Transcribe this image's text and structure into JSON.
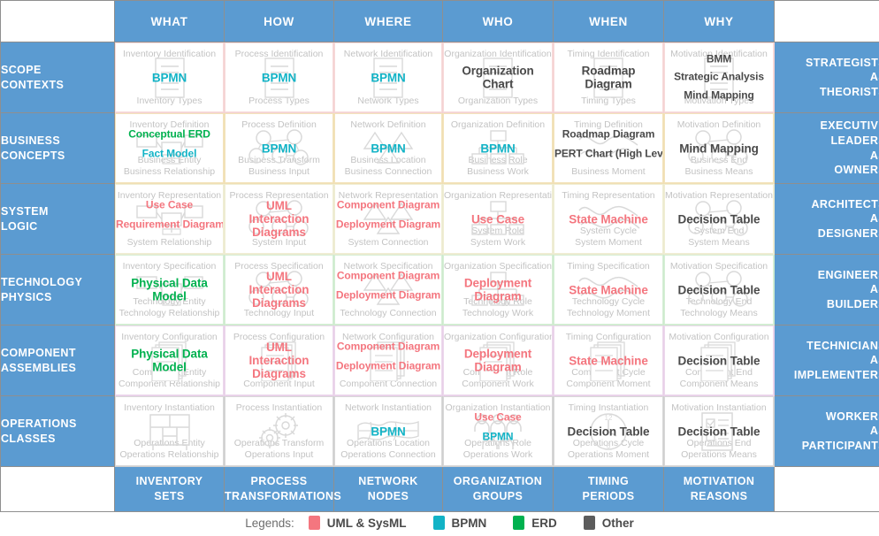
{
  "theme": {
    "header_blue": "#5b9bd1",
    "uml_color": "#f4767f",
    "bpmn_color": "#12b3c6",
    "erd_color": "#00b14f",
    "other_color": "#4a4a4a",
    "caption_gray": "#c3c3c3"
  },
  "columns": [
    {
      "key": "what",
      "label": "WHAT"
    },
    {
      "key": "how",
      "label": "HOW"
    },
    {
      "key": "where",
      "label": "WHERE"
    },
    {
      "key": "who",
      "label": "WHO"
    },
    {
      "key": "when",
      "label": "WHEN"
    },
    {
      "key": "why",
      "label": "WHY"
    }
  ],
  "footer": [
    {
      "line1": "INVENTORY",
      "line2": "SETS"
    },
    {
      "line1": "PROCESS",
      "line2": "TRANSFORMATIONS"
    },
    {
      "line1": "NETWORK",
      "line2": "NODES"
    },
    {
      "line1": "ORGANIZATION",
      "line2": "GROUPS"
    },
    {
      "line1": "TIMING",
      "line2": "PERIODS"
    },
    {
      "line1": "MOTIVATION",
      "line2": "REASONS"
    }
  ],
  "rows": [
    {
      "head_line1": "SCOPE",
      "head_line2": "CONTEXTS",
      "tail": "STRATEGISTS\nAS\nTHEORISTS",
      "tint": "rose",
      "cells": [
        {
          "top": "Inventory Identification",
          "bottom": "Inventory Types",
          "icon": "document-icon",
          "labels": [
            {
              "text": "BPMN",
              "kind": "bpmn"
            }
          ]
        },
        {
          "top": "Process Identification",
          "bottom": "Process Types",
          "icon": "document-icon",
          "labels": [
            {
              "text": "BPMN",
              "kind": "bpmn"
            }
          ]
        },
        {
          "top": "Network Identification",
          "bottom": "Network Types",
          "icon": "document-icon",
          "labels": [
            {
              "text": "BPMN",
              "kind": "bpmn"
            }
          ]
        },
        {
          "top": "Organization Identification",
          "bottom": "Organization Types",
          "icon": "document-icon",
          "labels": [
            {
              "text": "Organization",
              "kind": "other"
            },
            {
              "text": "Chart",
              "kind": "other"
            }
          ]
        },
        {
          "top": "Timing Identification",
          "bottom": "Timing Types",
          "icon": "document-icon",
          "labels": [
            {
              "text": "Roadmap",
              "kind": "other"
            },
            {
              "text": "Diagram",
              "kind": "other"
            }
          ]
        },
        {
          "top": "Motivation Identification",
          "bottom": "Motivation Types",
          "icon": "document-icon",
          "labels": [
            {
              "text": "BMM",
              "kind": "other",
              "size": "sm"
            },
            {
              "text": "Strategic Analysis",
              "kind": "other",
              "size": "sm",
              "gap": "gap-md"
            },
            {
              "text": "Mind Mapping",
              "kind": "other",
              "size": "sm"
            }
          ]
        }
      ]
    },
    {
      "head_line1": "BUSINESS",
      "head_line2": "CONCEPTS",
      "tail": "EXECUTIVE\nLEADERS\nAS\nOWNERS",
      "tint": "amber",
      "cells": [
        {
          "top": "Inventory Definition",
          "bottom": "Business Entity\nBusiness Relationship",
          "icon": "erd-icon",
          "labels": [
            {
              "text": "Conceptual ERD",
              "kind": "erd",
              "size": "sm"
            },
            {
              "text": "Fact Model",
              "kind": "bpmn",
              "size": "sm",
              "gap": "gap-lg"
            }
          ]
        },
        {
          "top": "Process Definition",
          "bottom": "Business Transform\nBusiness Input",
          "icon": "network-icon",
          "labels": [
            {
              "text": "BPMN",
              "kind": "bpmn"
            }
          ]
        },
        {
          "top": "Network Definition",
          "bottom": "Business Location\nBusiness Connection",
          "icon": "triangle-icon",
          "labels": [
            {
              "text": "BPMN",
              "kind": "bpmn"
            }
          ]
        },
        {
          "top": "Organization Definition",
          "bottom": "Business Role\nBusiness Work",
          "icon": "orgchart-icon",
          "labels": [
            {
              "text": "BPMN",
              "kind": "bpmn"
            }
          ]
        },
        {
          "top": "Timing Definition",
          "bottom": "Business Moment",
          "icon": "wave-icon",
          "labels": [
            {
              "text": "Roadmap Diagram",
              "kind": "other",
              "size": "sm"
            },
            {
              "text": "PERT Chart (High Level)",
              "kind": "other",
              "size": "sm",
              "gap": "gap-lg"
            }
          ]
        },
        {
          "top": "Motivation Definition",
          "bottom": "Business End\nBusiness Means",
          "icon": "network-icon",
          "labels": [
            {
              "text": "Mind Mapping",
              "kind": "other"
            }
          ]
        }
      ]
    },
    {
      "head_line1": "SYSTEM",
      "head_line2": "LOGIC",
      "tail": "ARCHITECTS\nAS\nDESIGNERS",
      "tint": "yellow",
      "cells": [
        {
          "top": "Inventory Representation",
          "bottom": "System Relationship",
          "icon": "erd-icon",
          "labels": [
            {
              "text": "Use Case",
              "kind": "uml",
              "size": "sm"
            },
            {
              "text": "Requirement Diagram",
              "kind": "uml",
              "size": "sm",
              "gap": "gap-lg"
            }
          ]
        },
        {
          "top": "Process Representation",
          "bottom": "System Input",
          "icon": "network-icon",
          "labels": [
            {
              "text": "UML",
              "kind": "uml"
            },
            {
              "text": "Interaction",
              "kind": "uml"
            },
            {
              "text": "Diagrams",
              "kind": "uml"
            }
          ]
        },
        {
          "top": "Network Representation",
          "bottom": "System Connection",
          "icon": "triangle-icon",
          "labels": [
            {
              "text": "Component Diagram",
              "kind": "uml",
              "size": "sm"
            },
            {
              "text": "Deployment Diagram",
              "kind": "uml",
              "size": "sm",
              "gap": "gap-lg"
            }
          ]
        },
        {
          "top": "Organization Representation",
          "bottom": "System Role\nSystem Work",
          "icon": "orgchart-icon",
          "labels": [
            {
              "text": "Use Case",
              "kind": "uml"
            }
          ]
        },
        {
          "top": "Timing Representation",
          "bottom": "System Cycle\nSystem Moment",
          "icon": "wave-icon",
          "labels": [
            {
              "text": "State Machine",
              "kind": "uml"
            }
          ]
        },
        {
          "top": "Motivation Representation",
          "bottom": "System End\nSystem Means",
          "icon": "network-icon",
          "labels": [
            {
              "text": "Decision Table",
              "kind": "other"
            }
          ]
        }
      ]
    },
    {
      "head_line1": "TECHNOLOGY",
      "head_line2": "PHYSICS",
      "tail": "ENGINEERS\nAS\nBUILDERS",
      "tint": "green",
      "cells": [
        {
          "top": "Inventory Specification",
          "bottom": "Technology Entity\nTechnology Relationship",
          "icon": "erd-icon",
          "labels": [
            {
              "text": "Physical Data",
              "kind": "erd"
            },
            {
              "text": "Model",
              "kind": "erd"
            }
          ]
        },
        {
          "top": "Process Specification",
          "bottom": "Technology Input",
          "icon": "network-icon",
          "labels": [
            {
              "text": "UML",
              "kind": "uml"
            },
            {
              "text": "Interaction",
              "kind": "uml"
            },
            {
              "text": "Diagrams",
              "kind": "uml"
            }
          ]
        },
        {
          "top": "Network Specification",
          "bottom": "Technology Connection",
          "icon": "triangle-icon",
          "labels": [
            {
              "text": "Component Diagram",
              "kind": "uml",
              "size": "sm"
            },
            {
              "text": "Deployment Diagram",
              "kind": "uml",
              "size": "sm",
              "gap": "gap-lg"
            }
          ]
        },
        {
          "top": "Organization Specification",
          "bottom": "Technology Role\nTechnology Work",
          "icon": "orgchart-icon",
          "labels": [
            {
              "text": "Deployment",
              "kind": "uml"
            },
            {
              "text": "Diagram",
              "kind": "uml"
            }
          ]
        },
        {
          "top": "Timing Specification",
          "bottom": "Technology Cycle\nTechnology Moment",
          "icon": "wave-icon",
          "labels": [
            {
              "text": "State Machine",
              "kind": "uml"
            }
          ]
        },
        {
          "top": "Motivation Specification",
          "bottom": "Technology End\nTechnology Means",
          "icon": "network-icon",
          "labels": [
            {
              "text": "Decision Table",
              "kind": "other"
            }
          ]
        }
      ]
    },
    {
      "head_line1": "COMPONENT",
      "head_line2": "ASSEMBLIES",
      "tail": "TECHNICIANS\nAS\nIMPLEMENTERS",
      "tint": "violet",
      "cells": [
        {
          "top": "Inventory Configuration",
          "bottom": "Component Entity\nComponent Relationship",
          "icon": "stack-icon",
          "labels": [
            {
              "text": "Physical Data",
              "kind": "erd"
            },
            {
              "text": "Model",
              "kind": "erd"
            }
          ]
        },
        {
          "top": "Process Configuration",
          "bottom": "Component Input",
          "icon": "stack-icon",
          "labels": [
            {
              "text": "UML",
              "kind": "uml"
            },
            {
              "text": "Interaction",
              "kind": "uml"
            },
            {
              "text": "Diagrams",
              "kind": "uml"
            }
          ]
        },
        {
          "top": "Network Configuration",
          "bottom": "Component Connection",
          "icon": "stack-icon",
          "labels": [
            {
              "text": "Component Diagram",
              "kind": "uml",
              "size": "sm"
            },
            {
              "text": "Deployment Diagram",
              "kind": "uml",
              "size": "sm",
              "gap": "gap-lg"
            }
          ]
        },
        {
          "top": "Organization Configuration",
          "bottom": "Component Role\nComponent Work",
          "icon": "stack-icon",
          "labels": [
            {
              "text": "Deployment",
              "kind": "uml"
            },
            {
              "text": "Diagram",
              "kind": "uml"
            }
          ]
        },
        {
          "top": "Timing Configuration",
          "bottom": "Component Cycle\nComponent Moment",
          "icon": "stack-icon",
          "labels": [
            {
              "text": "State Machine",
              "kind": "uml"
            }
          ]
        },
        {
          "top": "Motivation Configuration",
          "bottom": "Component End\nComponent Means",
          "icon": "stack-icon",
          "labels": [
            {
              "text": "Decision Table",
              "kind": "other"
            }
          ]
        }
      ]
    },
    {
      "head_line1": "OPERATIONS",
      "head_line2": "CLASSES",
      "tail": "WORKERS\nAS\nPARTICIPANTS",
      "tint": "gray",
      "cells": [
        {
          "top": "Inventory Instantiation",
          "bottom": "Operations Entity\nOperations Relationship",
          "icon": "shelf-icon",
          "labels": []
        },
        {
          "top": "Process Instantiation",
          "bottom": "Operations Transform\nOperations Input",
          "icon": "gears-icon",
          "labels": []
        },
        {
          "top": "Network Instantiation",
          "bottom": "Operations Location\nOperations Connection",
          "icon": "globe-icon",
          "labels": [
            {
              "text": "BPMN",
              "kind": "bpmn"
            }
          ]
        },
        {
          "top": "Organization Instantiation",
          "bottom": "Operations Role\nOperations Work",
          "icon": "people-icon",
          "labels": [
            {
              "text": "Use Case",
              "kind": "uml",
              "size": "sm"
            },
            {
              "text": "BPMN",
              "kind": "bpmn",
              "size": "sm",
              "gap": "gap-lg"
            }
          ]
        },
        {
          "top": "Timing Instantiation",
          "bottom": "Operations Cycle\nOperations Moment",
          "icon": "clock-icon",
          "labels": [
            {
              "text": "Decision Table",
              "kind": "other"
            }
          ]
        },
        {
          "top": "Motivation Instantiation",
          "bottom": "Operations End\nOperations Means",
          "icon": "checklist-icon",
          "labels": [
            {
              "text": "Decision Table",
              "kind": "other"
            }
          ]
        }
      ]
    }
  ],
  "legends": {
    "title": "Legends:",
    "items": [
      {
        "label": "UML & SysML",
        "color": "#f4767f"
      },
      {
        "label": "BPMN",
        "color": "#12b3c6"
      },
      {
        "label": "ERD",
        "color": "#00b14f"
      },
      {
        "label": "Other",
        "color": "#5c5c5c"
      }
    ]
  }
}
